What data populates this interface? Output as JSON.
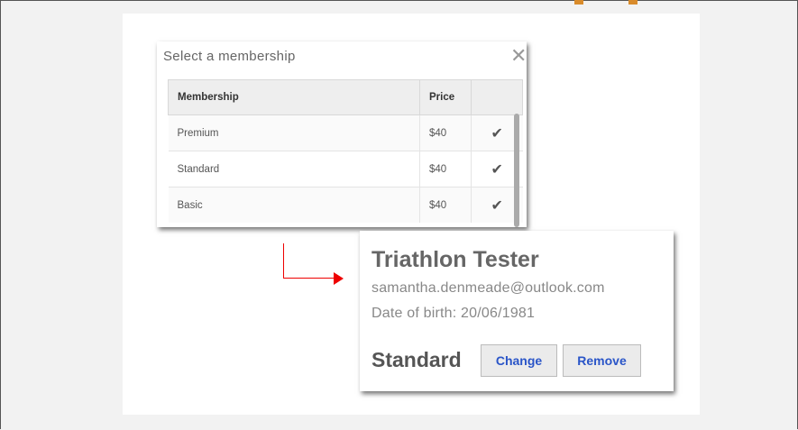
{
  "dialog": {
    "title": "Select a membership",
    "close_glyph": "✕",
    "columns": [
      "Membership",
      "Price",
      ""
    ],
    "rows": [
      {
        "name": "Premium",
        "price": "$40",
        "check": "✔"
      },
      {
        "name": "Standard",
        "price": "$40",
        "check": "✔"
      },
      {
        "name": "Basic",
        "price": "$40",
        "check": "✔"
      }
    ]
  },
  "card": {
    "name": "Triathlon Tester",
    "email": "samantha.denmeade@outlook.com",
    "dob": "Date of birth: 20/06/1981",
    "plan": "Standard",
    "change_label": "Change",
    "remove_label": "Remove"
  },
  "colors": {
    "accent": "#2a55c8",
    "arrow": "#ee0000"
  }
}
